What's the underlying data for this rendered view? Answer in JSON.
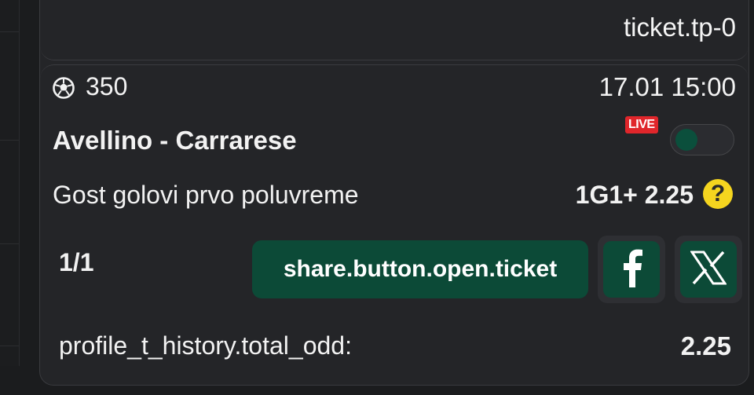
{
  "header": {
    "ticket_id": "ticket.tp-0"
  },
  "event": {
    "code": "350",
    "sport_icon": "soccer-ball-icon",
    "datetime": "17.01 15:00",
    "teams": "Avellino - Carrarese",
    "live_badge": "LIVE",
    "live_toggle_on": false,
    "market": "Gost golovi prvo poluvreme",
    "pick": "1G1+ 2.25",
    "help_icon": "question-circle-icon"
  },
  "actions": {
    "count": "1/1",
    "share_label": "share.button.open.ticket",
    "facebook_icon": "facebook-icon",
    "x_icon": "x-icon"
  },
  "totals": {
    "label": "profile_t_history.total_odd:",
    "value": "2.25"
  },
  "colors": {
    "accent_green": "#0c4a37",
    "live_red": "#e0262b",
    "help_yellow": "#f5d51f",
    "panel_bg": "#242528"
  }
}
